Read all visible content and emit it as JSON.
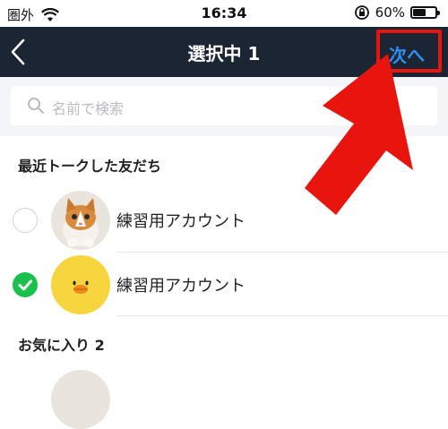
{
  "status_bar": {
    "carrier": "圏外",
    "time": "16:34",
    "battery_percent": "60%",
    "battery_level": 0.6
  },
  "header": {
    "title": "選択中 1",
    "next_label": "次へ"
  },
  "search": {
    "placeholder": "名前で検索"
  },
  "sections": {
    "recent_title": "最近トークした友だち",
    "favorites_title": "お気に入り 2"
  },
  "contacts": [
    {
      "name": "練習用アカウント",
      "selected": false,
      "avatar": "kitten"
    },
    {
      "name": "練習用アカウント",
      "selected": true,
      "avatar": "yellow-chick"
    }
  ],
  "colors": {
    "header_bg": "#1c2534",
    "accent": "#2f8ff0",
    "check_green": "#1ac04c",
    "annotation_red": "#e8150f"
  }
}
